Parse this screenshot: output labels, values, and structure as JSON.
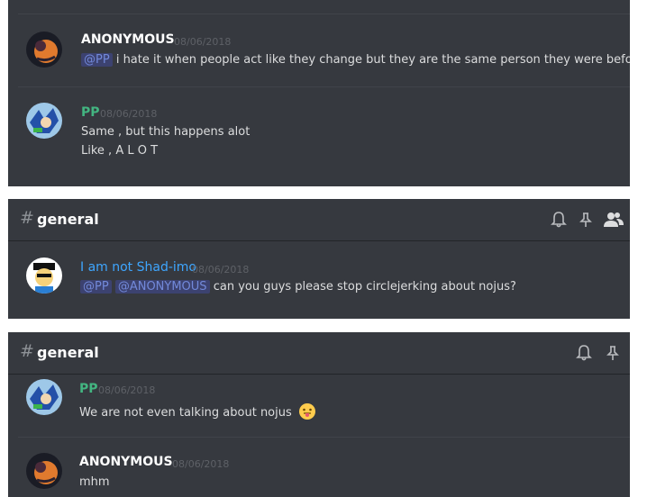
{
  "channel": {
    "hash": "#",
    "name": "general"
  },
  "panel1": {
    "m1": {
      "author": "ANONYMOUS",
      "timestamp": "08/06/2018",
      "mention": "@PP",
      "text": "i hate it when people act like they change but they are the same person they were before :/"
    },
    "m2": {
      "author": "PP",
      "timestamp": "08/06/2018",
      "line1": "Same , but this happens alot",
      "line2": "Like , A L O T"
    }
  },
  "panel2": {
    "m1": {
      "author": "I am not Shad-imo",
      "timestamp": "08/06/2018",
      "mention1": "@PP",
      "mention2": "@ANONYMOUS",
      "text": "can you guys please stop circlejerking about nojus?"
    }
  },
  "panel3": {
    "m1": {
      "author": "PP",
      "timestamp": "08/06/2018",
      "text": "We are not even talking about nojus"
    },
    "m2": {
      "author": "ANONYMOUS",
      "timestamp": "08/06/2018",
      "text": "mhm"
    }
  },
  "icons": {
    "notification": "bell-icon",
    "pinned": "pin-icon",
    "members": "members-icon",
    "emoji": "tongue-out-emoji"
  },
  "colors": {
    "background": "#36393f",
    "author_default": "#ffffff",
    "author_pp": "#43b581",
    "author_shad": "#3ea6ff",
    "mention": "#7289da",
    "timestamp": "#5e6167"
  }
}
